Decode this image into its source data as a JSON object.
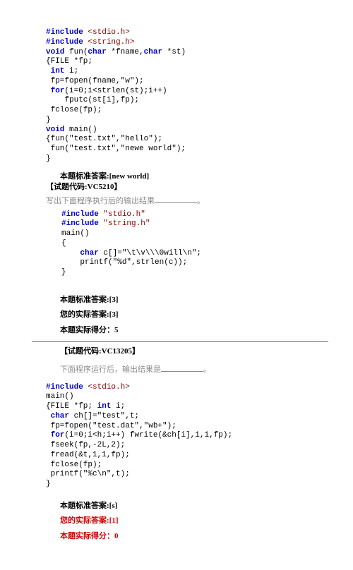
{
  "q1": {
    "code": [
      {
        "cls": "idt-0",
        "segs": [
          {
            "t": "#include ",
            "k": "kw"
          },
          {
            "t": "<stdio.h>",
            "k": "str"
          }
        ]
      },
      {
        "cls": "idt-0",
        "segs": [
          {
            "t": "#include ",
            "k": "kw"
          },
          {
            "t": "<string.h>",
            "k": "str"
          }
        ]
      },
      {
        "cls": "idt-0",
        "segs": [
          {
            "t": "void ",
            "k": "kw"
          },
          {
            "t": "fun("
          },
          {
            "t": "char",
            "k": "kw"
          },
          {
            "t": " *fname,"
          },
          {
            "t": "char",
            "k": "kw"
          },
          {
            "t": " *st)"
          }
        ]
      },
      {
        "cls": "idt-0",
        "segs": [
          {
            "t": "{FILE *fp;"
          }
        ]
      },
      {
        "cls": "idt-0",
        "segs": [
          {
            "t": " "
          },
          {
            "t": "int",
            "k": "kw"
          },
          {
            "t": " i;"
          }
        ]
      },
      {
        "cls": "idt-0",
        "segs": [
          {
            "t": " fp=fopen(fname,\"w\");"
          }
        ]
      },
      {
        "cls": "idt-0",
        "segs": [
          {
            "t": " "
          },
          {
            "t": "for",
            "k": "kw"
          },
          {
            "t": "(i=0;i<strlen(st);i++)"
          }
        ]
      },
      {
        "cls": "idt-0",
        "segs": [
          {
            "t": "    fputc(st[i],fp);"
          }
        ]
      },
      {
        "cls": "idt-0",
        "segs": [
          {
            "t": " fclose(fp);"
          }
        ]
      },
      {
        "cls": "idt-0",
        "segs": [
          {
            "t": "}"
          }
        ]
      },
      {
        "cls": "idt-0",
        "segs": [
          {
            "t": "void ",
            "k": "kw"
          },
          {
            "t": "main()"
          }
        ]
      },
      {
        "cls": "idt-0",
        "segs": [
          {
            "t": "{fun(\"test.txt\",\"hello\");"
          }
        ]
      },
      {
        "cls": "idt-0",
        "segs": [
          {
            "t": " fun(\"test.txt\",\"newe world\");"
          }
        ]
      },
      {
        "cls": "idt-0",
        "segs": [
          {
            "t": "}"
          }
        ]
      }
    ],
    "std_label": "本题标准答案:",
    "std_val": "[new world]",
    "qid_label": "【试题代码:VC5210】"
  },
  "q2": {
    "prompt_pre": "写出下面程序执行后的输出结果",
    "prompt_post": "。",
    "code": [
      {
        "cls": "idt-0",
        "segs": [
          {
            "t": "#include ",
            "k": "kw"
          },
          {
            "t": "\"stdio.h\"",
            "k": "str"
          }
        ]
      },
      {
        "cls": "idt-0",
        "segs": [
          {
            "t": "#include ",
            "k": "kw"
          },
          {
            "t": "\"string.h\"",
            "k": "str"
          }
        ]
      },
      {
        "cls": "idt-0",
        "segs": [
          {
            "t": "main()"
          }
        ]
      },
      {
        "cls": "idt-0",
        "segs": [
          {
            "t": "{"
          }
        ]
      },
      {
        "cls": "idt-0",
        "segs": [
          {
            "t": "    "
          },
          {
            "t": "char",
            "k": "kw"
          },
          {
            "t": " c[]=\"\\t\\v\\\\\\0will\\n\";"
          }
        ]
      },
      {
        "cls": "idt-0",
        "segs": [
          {
            "t": "    printf(\"%d\",strlen(c));"
          }
        ]
      },
      {
        "cls": "idt-0",
        "segs": [
          {
            "t": "}"
          }
        ]
      }
    ],
    "std_label": "本题标准答案:",
    "std_val": "[3]",
    "your_label": "您的实际答案:",
    "your_val": "[3]",
    "score_label": "本题实际得分：",
    "score_val": "5"
  },
  "q3": {
    "qid_label": "【试题代码:VC13205】",
    "prompt_pre": "下面程序运行后，输出结果是",
    "prompt_post": "。",
    "code": [
      {
        "cls": "idt-0",
        "segs": [
          {
            "t": "#include ",
            "k": "kw"
          },
          {
            "t": "<stdio.h>",
            "k": "str"
          }
        ]
      },
      {
        "cls": "idt-0",
        "segs": [
          {
            "t": "main()"
          }
        ]
      },
      {
        "cls": "idt-0",
        "segs": [
          {
            "t": "{FILE *fp; "
          },
          {
            "t": "int",
            "k": "kw"
          },
          {
            "t": " i;"
          }
        ]
      },
      {
        "cls": "idt-0",
        "segs": [
          {
            "t": " "
          },
          {
            "t": "char",
            "k": "kw"
          },
          {
            "t": " ch[]=\"test\",t;"
          }
        ]
      },
      {
        "cls": "idt-0",
        "segs": [
          {
            "t": " fp=fopen(\"test.dat\",\"wb+\");"
          }
        ]
      },
      {
        "cls": "idt-0",
        "segs": [
          {
            "t": " "
          },
          {
            "t": "for",
            "k": "kw"
          },
          {
            "t": "(i=0;i<h;i++) fwrite(&ch[i],1,1,fp);"
          }
        ]
      },
      {
        "cls": "idt-0",
        "segs": [
          {
            "t": " fseek(fp,-2L,2);"
          }
        ]
      },
      {
        "cls": "idt-0",
        "segs": [
          {
            "t": " fread(&t,1,1,fp);"
          }
        ]
      },
      {
        "cls": "idt-0",
        "segs": [
          {
            "t": " fclose(fp);"
          }
        ]
      },
      {
        "cls": "idt-0",
        "segs": [
          {
            "t": " printf(\"%c\\n\",t);"
          }
        ]
      },
      {
        "cls": "idt-0",
        "segs": [
          {
            "t": "}"
          }
        ]
      }
    ],
    "std_label": "本题标准答案:",
    "std_val": "[s]",
    "your_label": "您的实际答案:",
    "your_val": "[1]",
    "score_label": "本题实际得分：",
    "score_val": "0"
  }
}
